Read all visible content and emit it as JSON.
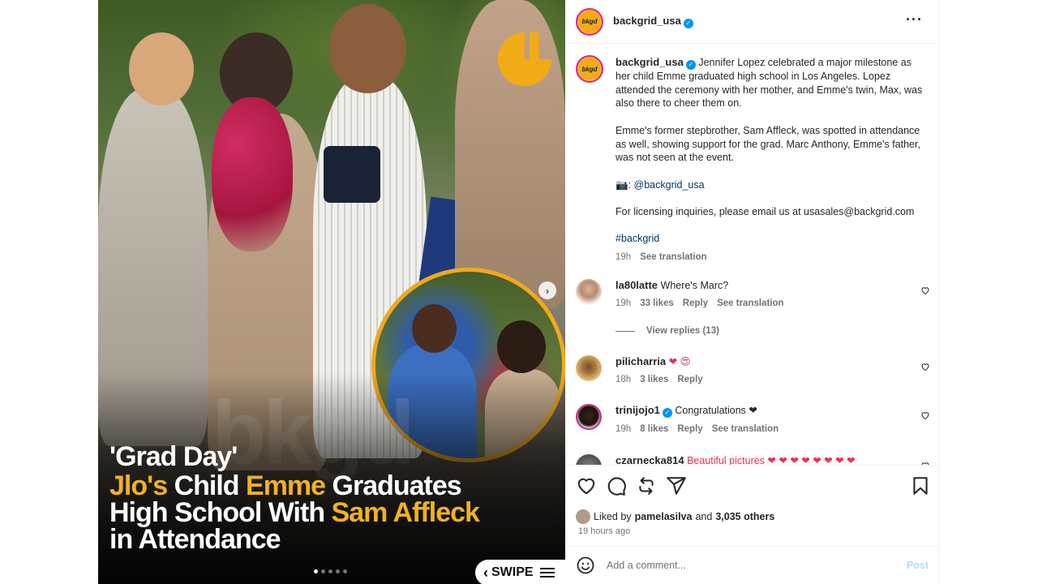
{
  "post": {
    "author": "backgrid_usa",
    "avatar_text": "bkgd",
    "more_icon": "more-horizontal-icon",
    "caption_intro": "Jennifer Lopez celebrated a major milestone as her child Emme graduated high school in Los Angeles. Lopez attended the ceremony with her mother, and Emme's twin, Max, was also there to cheer them on.",
    "caption_p2": "Emme's former stepbrother, Sam Affleck, was spotted in attendance as well, showing support for the grad. Marc Anthony, Emme's father, was not seen at the event.",
    "camera_emoji": "📷:",
    "credit_handle": "@backgrid_usa",
    "licensing": "For licensing inquiries, please email us at usasales@backgrid.com",
    "hashtag": "#backgrid",
    "caption_time": "19h",
    "see_translation": "See translation"
  },
  "media": {
    "kicker": "'Grad Day'",
    "line1_a": "Jlo's",
    "line1_b": " Child ",
    "line1_c": "Emme",
    "line1_d": " Graduates",
    "line2_a": "High School With ",
    "line2_b": "Sam Affleck",
    "line3": "in Attendance",
    "watermark": "bkgd",
    "swipe_label": "SWIPE",
    "slides_total": 5,
    "slide_active": 1,
    "accent": "#f2b21c"
  },
  "comments": [
    {
      "user": "la80latte",
      "text": "Where's Marc?",
      "time": "19h",
      "likes": "33 likes",
      "reply": "Reply",
      "translate": "See translation",
      "view_replies": "View replies (13)"
    },
    {
      "user": "pilicharria",
      "text": "❤ 😍",
      "time": "18h",
      "likes": "3 likes",
      "reply": "Reply"
    },
    {
      "user": "trinijojo1",
      "text": "Congratulations ❤",
      "time": "19h",
      "likes": "8 likes",
      "reply": "Reply",
      "translate": "See translation"
    },
    {
      "user": "czarnecka814",
      "text": "Beautiful pictures ❤ ❤ ❤ ❤ ❤ ❤ ❤ ❤"
    }
  ],
  "likes": {
    "liked_by_prefix": "Liked by",
    "liked_by_user": "pamelasilva",
    "and_text": "and",
    "others": "3,035 others",
    "time_ago": "19 hours ago"
  },
  "composer": {
    "placeholder": "Add a comment...",
    "post_label": "Post"
  }
}
